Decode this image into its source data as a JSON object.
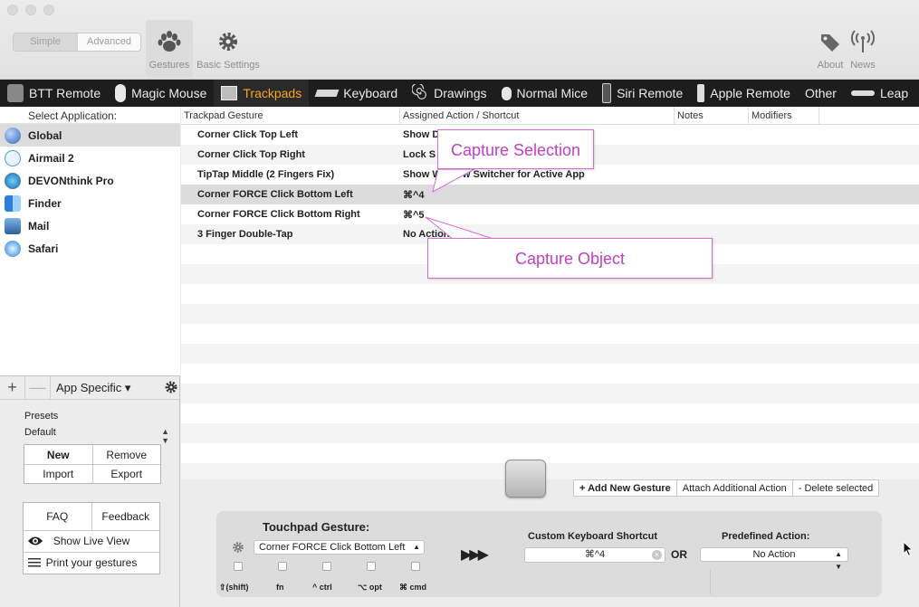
{
  "toolbar": {
    "mode_simple": "Simple",
    "mode_advanced": "Advanced",
    "gestures_label": "Gestures",
    "basic_settings_label": "Basic Settings",
    "about_label": "About",
    "news_label": "News"
  },
  "tabs": [
    {
      "label": "BTT Remote",
      "icon": "btt-remote-icon"
    },
    {
      "label": "Magic Mouse",
      "icon": "magic-mouse-icon"
    },
    {
      "label": "Trackpads",
      "icon": "trackpad-icon",
      "active": true
    },
    {
      "label": "Keyboard",
      "icon": "keyboard-icon"
    },
    {
      "label": "Drawings",
      "icon": "drawings-icon"
    },
    {
      "label": "Normal Mice",
      "icon": "mouse-icon"
    },
    {
      "label": "Siri Remote",
      "icon": "siri-remote-icon"
    },
    {
      "label": "Apple Remote",
      "icon": "apple-remote-icon"
    },
    {
      "label": "Other",
      "icon": ""
    },
    {
      "label": "Leap",
      "icon": "leap-icon"
    }
  ],
  "apps": {
    "header": "Select Application:",
    "items": [
      {
        "name": "Global",
        "icon": "globe-icon",
        "selected": true
      },
      {
        "name": "Airmail 2",
        "icon": "airmail-icon"
      },
      {
        "name": "DEVONthink Pro",
        "icon": "devonthink-icon"
      },
      {
        "name": "Finder",
        "icon": "finder-icon"
      },
      {
        "name": "Mail",
        "icon": "mail-icon"
      },
      {
        "name": "Safari",
        "icon": "safari-icon"
      }
    ],
    "add": "+",
    "remove": "—",
    "app_specific": "App Specific ▾"
  },
  "presets": {
    "label": "Presets",
    "selected": "Default",
    "new": "New",
    "remove": "Remove",
    "import": "Import",
    "export": "Export"
  },
  "help": {
    "faq": "FAQ",
    "feedback": "Feedback",
    "live_view": "Show Live View",
    "print": "Print your gestures"
  },
  "table": {
    "columns": [
      "Trackpad Gesture",
      "Assigned Action / Shortcut",
      "Notes",
      "Modifiers"
    ],
    "rows": [
      {
        "gesture": "Corner Click Top Left",
        "action": "Show D"
      },
      {
        "gesture": "Corner Click Top Right",
        "action": "Lock S"
      },
      {
        "gesture": "TipTap Middle (2 Fingers Fix)",
        "action": "Show Window Switcher for Active App"
      },
      {
        "gesture": "Corner FORCE Click Bottom Left",
        "action": "⌘^4",
        "selected": true
      },
      {
        "gesture": "Corner FORCE Click Bottom Right",
        "action": "⌘^5"
      },
      {
        "gesture": "3 Finger Double-Tap",
        "action": "No Action"
      }
    ]
  },
  "callouts": {
    "capture_selection": "Capture Selection",
    "capture_object": "Capture Object"
  },
  "actions": {
    "add_gesture": "+ Add New Gesture",
    "attach_action": "Attach Additional Action",
    "delete_selected": "- Delete selected"
  },
  "editor": {
    "title": "Touchpad Gesture:",
    "gesture_value": "Corner FORCE Click Bottom Left",
    "modifiers": [
      "⇧(shift)",
      "fn",
      "^ ctrl",
      "⌥ opt",
      "⌘ cmd"
    ],
    "arrows": "▶▶▶",
    "custom_shortcut_label": "Custom Keyboard Shortcut",
    "custom_shortcut_value": "⌘^4",
    "or": "OR",
    "predefined_label": "Predefined Action:",
    "predefined_value": "No Action"
  }
}
